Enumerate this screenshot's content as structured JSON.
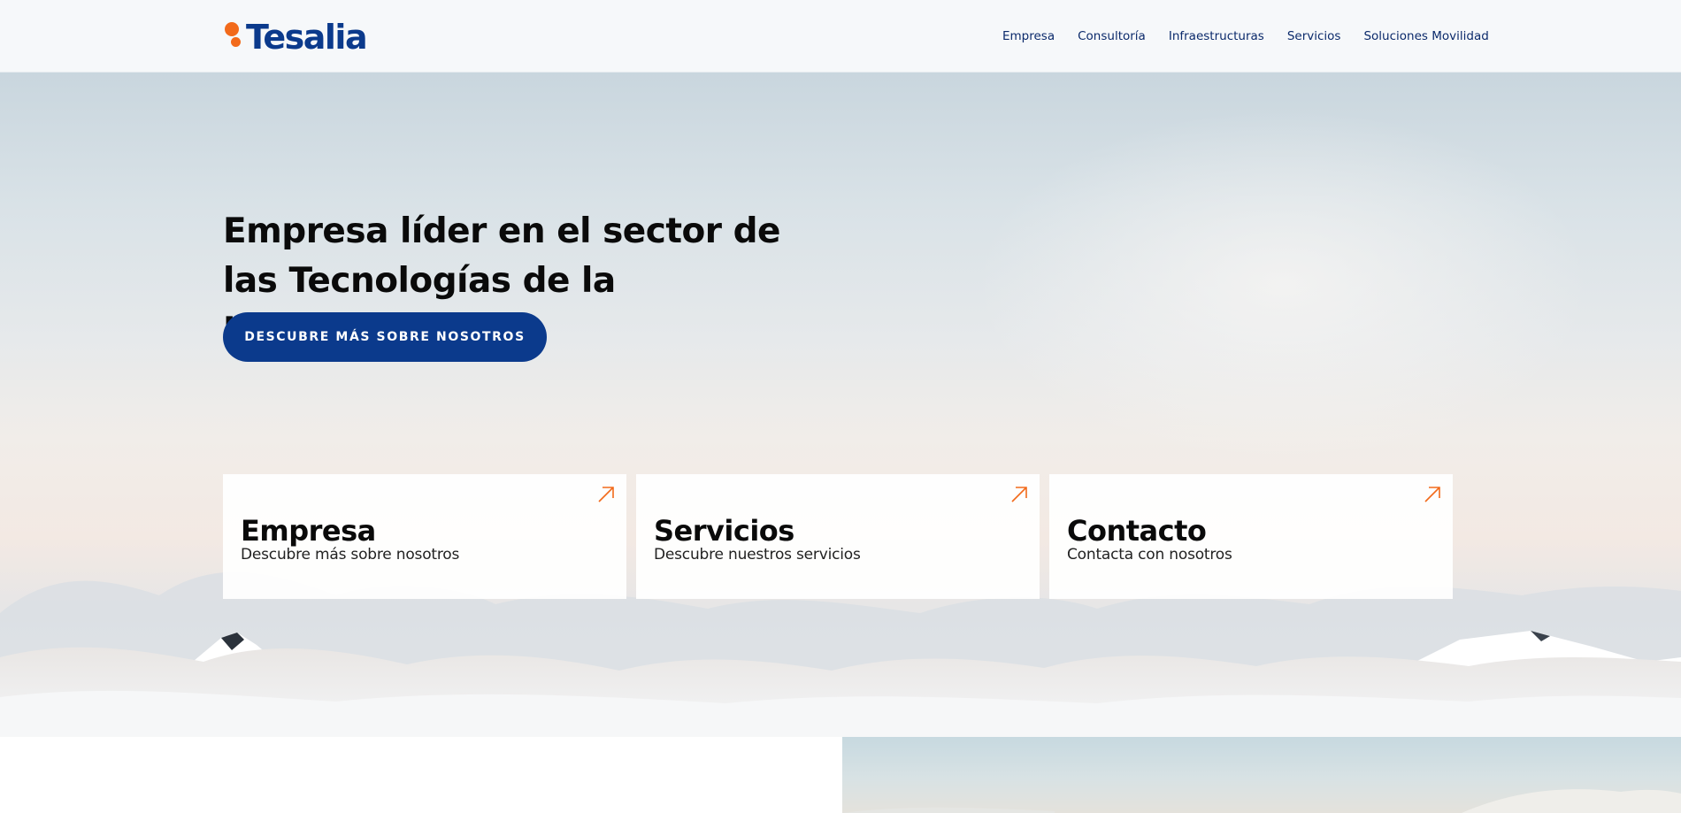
{
  "header": {
    "logo_text": "Tesalia",
    "nav": [
      {
        "label": "Empresa"
      },
      {
        "label": "Consultoría"
      },
      {
        "label": "Infraestructuras"
      },
      {
        "label": "Servicios"
      },
      {
        "label": "Soluciones Movilidad"
      }
    ]
  },
  "hero": {
    "title": "Empresa líder en el sector de las Tecnologías de la Información",
    "cta_label": "DESCUBRE MÁS SOBRE NOSOTROS",
    "cards": [
      {
        "title": "Empresa",
        "subtitle": "Descubre más sobre nosotros",
        "icon": "arrow-up-right-icon"
      },
      {
        "title": "Servicios",
        "subtitle": "Descubre nuestros servicios",
        "icon": "arrow-up-right-icon"
      },
      {
        "title": "Contacto",
        "subtitle": "Contacta con nosotros",
        "icon": "arrow-up-right-icon"
      }
    ]
  },
  "colors": {
    "brand_blue": "#0b3a8c",
    "accent_orange": "#f26a1b",
    "nav_text": "#0b2a6b"
  }
}
